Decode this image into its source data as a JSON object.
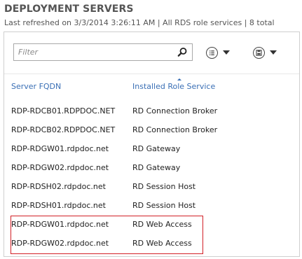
{
  "header": {
    "title": "DEPLOYMENT SERVERS",
    "subtitle": "Last refreshed on 3/3/2014 3:26:11 AM | All RDS role services  | 8 total"
  },
  "toolbar": {
    "filter_placeholder": "Filter",
    "filter_value": "",
    "icons": {
      "search": "search-icon",
      "queries": "list-icon",
      "save": "save-icon",
      "dropdown": "chevron-down-icon"
    }
  },
  "table": {
    "columns": [
      "Server FQDN",
      "Installed Role Service"
    ],
    "sorted_column": "Installed Role Service",
    "rows": [
      {
        "fqdn": "RDP-RDCB01.RDPDOC.NET",
        "role": "RD Connection Broker"
      },
      {
        "fqdn": "RDP-RDCB02.RDPDOC.NET",
        "role": "RD Connection Broker"
      },
      {
        "fqdn": "RDP-RDGW01.rdpdoc.net",
        "role": "RD Gateway"
      },
      {
        "fqdn": "RDP-RDGW02.rdpdoc.net",
        "role": "RD Gateway"
      },
      {
        "fqdn": "RDP-RDSH02.rdpdoc.net",
        "role": "RD Session Host"
      },
      {
        "fqdn": "RDP-RDSH01.rdpdoc.net",
        "role": "RD Session Host"
      },
      {
        "fqdn": "RDP-RDGW01.rdpdoc.net",
        "role": "RD Web Access"
      },
      {
        "fqdn": "RDP-RDGW02.rdpdoc.net",
        "role": "RD Web Access"
      }
    ]
  },
  "colors": {
    "header_link": "#3a6fb5",
    "highlight_border": "#d21f26",
    "title_text": "#555555"
  }
}
